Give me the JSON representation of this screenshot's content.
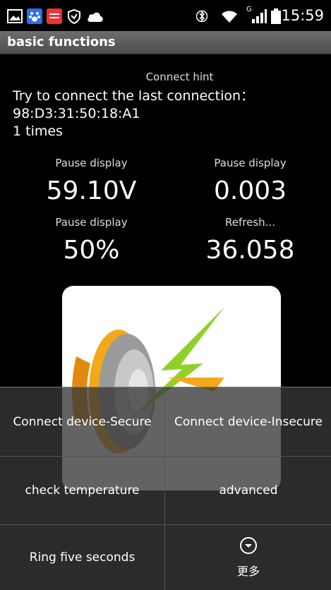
{
  "status_bar": {
    "time": "15:59",
    "left_icons": [
      "image-icon",
      "baidu-icon",
      "news-app-icon",
      "shield-icon",
      "cloud-icon"
    ],
    "right_icons": [
      "bluetooth-icon",
      "wifi-icon",
      "signal-icon",
      "battery-icon"
    ],
    "network_type": "G"
  },
  "title_bar": {
    "title": "basic functions"
  },
  "hint": {
    "title": "Connect hint",
    "body": "Try to connect the last connection：98:D3:31:50:18:A1\n1 times"
  },
  "metrics": [
    {
      "label": "Pause display",
      "value": "59.10V"
    },
    {
      "label": "Pause display",
      "value": "0.003"
    },
    {
      "label": "Pause display",
      "value": "50%"
    },
    {
      "label": "Refresh...",
      "value": "36.058"
    }
  ],
  "menu": {
    "items": [
      {
        "label": "Connect device-Secure"
      },
      {
        "label": "Connect device-Insecure"
      },
      {
        "label": "check temperature"
      },
      {
        "label": "advanced"
      },
      {
        "label": "Ring five seconds"
      }
    ],
    "more_label": "更多"
  },
  "colors": {
    "background": "#000000",
    "title_bar": "#5c5c5c",
    "menu_overlay": "#373737"
  }
}
